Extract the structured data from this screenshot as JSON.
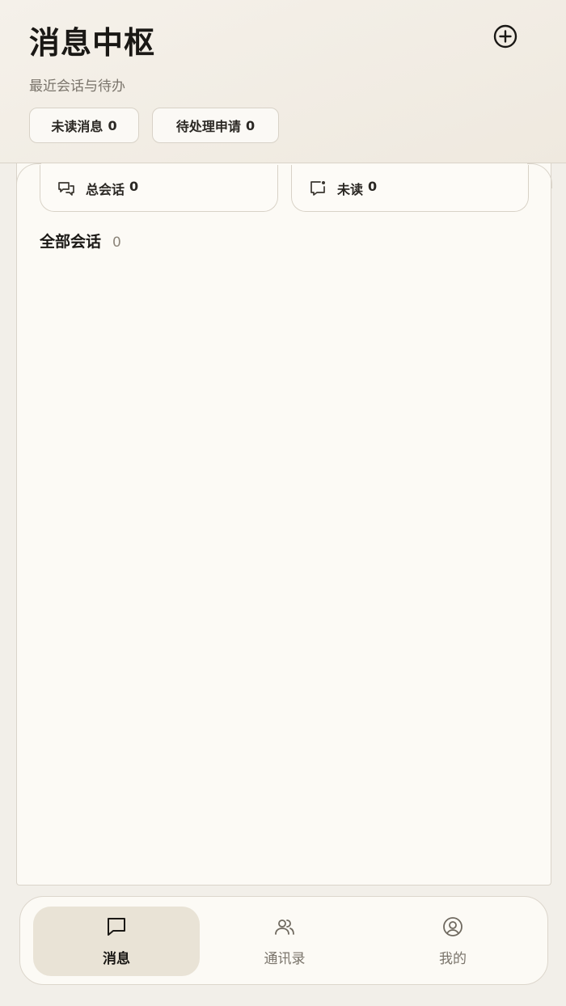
{
  "header": {
    "title": "消息中枢",
    "subtitle": "最近会话与待办",
    "add_icon": "plus-circle-icon",
    "chips": [
      {
        "label": "未读消息",
        "count": "0"
      },
      {
        "label": "待处理申请",
        "count": "0"
      }
    ]
  },
  "stats": [
    {
      "icon": "chat-bubbles-icon",
      "label": "总会话",
      "count": "0"
    },
    {
      "icon": "chat-unread-icon",
      "label": "未读",
      "count": "0"
    }
  ],
  "section": {
    "label": "全部会话",
    "count": "0"
  },
  "tabbar": {
    "active": "消息",
    "tabs": [
      {
        "label": "消息",
        "icon": "message-square-icon"
      },
      {
        "label": "通讯录",
        "icon": "users-icon"
      },
      {
        "label": "我的",
        "icon": "user-circle-icon"
      }
    ]
  },
  "colors": {
    "background": "#f2efe9",
    "panel": "#fcfaf5",
    "active_tab": "#e9e3d6",
    "text": "#1a1815",
    "muted": "#7a746b"
  }
}
